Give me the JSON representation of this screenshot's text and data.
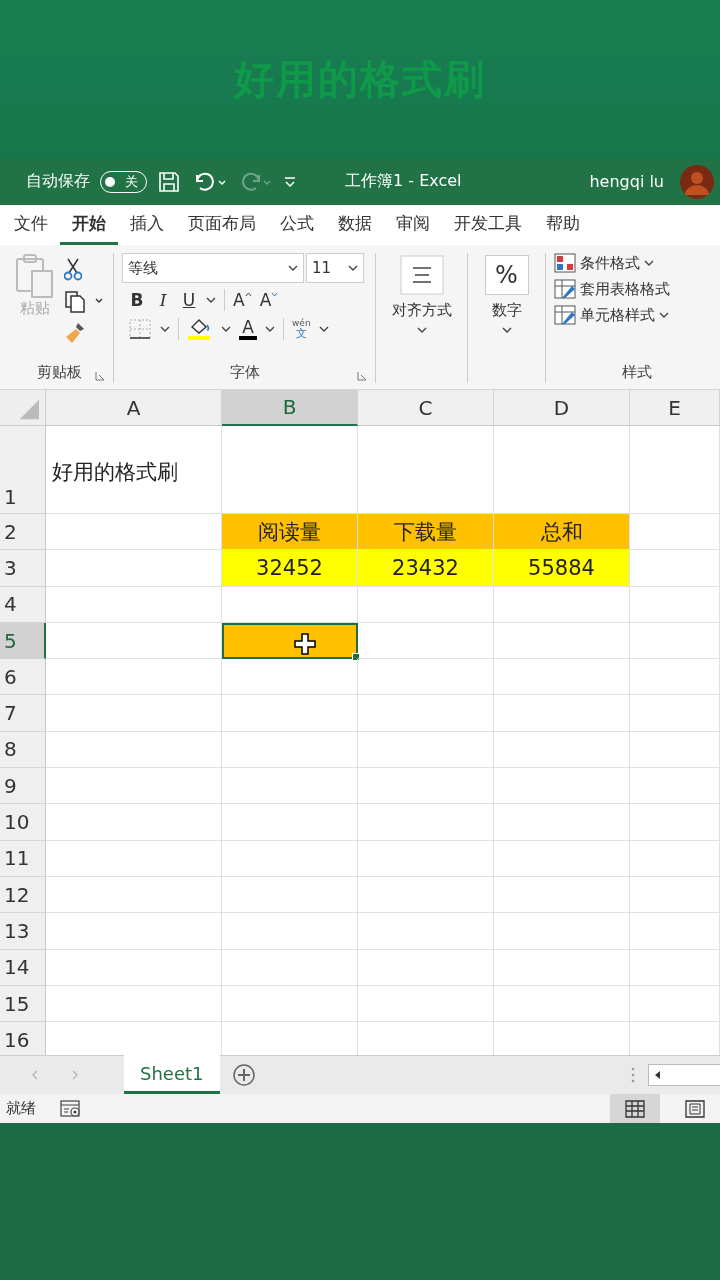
{
  "banner": {
    "title": "好用的格式刷"
  },
  "titlebar": {
    "autosave_label": "自动保存",
    "autosave_toggle": {
      "label": "关",
      "on": false
    },
    "doc_title": "工作簿1  -  Excel",
    "user": "hengqi lu"
  },
  "tabs": [
    {
      "label": "文件",
      "selected": false
    },
    {
      "label": "开始",
      "selected": true
    },
    {
      "label": "插入",
      "selected": false
    },
    {
      "label": "页面布局",
      "selected": false
    },
    {
      "label": "公式",
      "selected": false
    },
    {
      "label": "数据",
      "selected": false
    },
    {
      "label": "审阅",
      "selected": false
    },
    {
      "label": "开发工具",
      "selected": false
    },
    {
      "label": "帮助",
      "selected": false
    }
  ],
  "ribbon": {
    "clipboard": {
      "paste": "粘贴",
      "group": "剪贴板"
    },
    "font": {
      "font_name": "等线",
      "font_size": "11",
      "bold": "B",
      "italic": "I",
      "underline": "U",
      "grow": "A",
      "shrink": "A",
      "font_color": "A",
      "phonetic_top": "wén",
      "phonetic_bottom": "文",
      "group": "字体"
    },
    "alignment": {
      "label": "对齐方式"
    },
    "number": {
      "symbol": "%",
      "label": "数字"
    },
    "styles": {
      "items": [
        {
          "label": "条件格式",
          "dropdown": true
        },
        {
          "label": "套用表格格式",
          "dropdown": false
        },
        {
          "label": "单元格样式",
          "dropdown": true
        }
      ],
      "group": "样式"
    }
  },
  "sheet": {
    "columns": [
      {
        "label": "A",
        "selected": false
      },
      {
        "label": "B",
        "selected": true
      },
      {
        "label": "C",
        "selected": false
      },
      {
        "label": "D",
        "selected": false
      },
      {
        "label": "E",
        "selected": false
      }
    ],
    "rows": [
      {
        "label": "1",
        "selected": false,
        "tall": true,
        "cells": [
          {
            "text": "好用的格式刷"
          },
          {},
          {},
          {},
          {}
        ]
      },
      {
        "label": "2",
        "selected": false,
        "cells": [
          {},
          {
            "text": "阅读量",
            "color": "#ffc000"
          },
          {
            "text": "下载量",
            "color": "#ffc000"
          },
          {
            "text": "总和",
            "color": "#ffc000"
          },
          {}
        ]
      },
      {
        "label": "3",
        "selected": false,
        "cells": [
          {},
          {
            "text": "32452",
            "color": "#ffff00"
          },
          {
            "text": "23432",
            "color": "#ffff00"
          },
          {
            "text": "55884",
            "color": "#ffff00"
          },
          {}
        ]
      },
      {
        "label": "4",
        "selected": false,
        "cells": [
          {},
          {},
          {},
          {},
          {}
        ]
      },
      {
        "label": "5",
        "selected": true,
        "cells": [
          {},
          {
            "color": "#ffc000",
            "active": true
          },
          {},
          {},
          {}
        ]
      },
      {
        "label": "6",
        "selected": false,
        "cells": [
          {},
          {},
          {},
          {},
          {}
        ]
      },
      {
        "label": "7",
        "selected": false,
        "cells": [
          {},
          {},
          {},
          {},
          {}
        ]
      },
      {
        "label": "8",
        "selected": false,
        "cells": [
          {},
          {},
          {},
          {},
          {}
        ]
      },
      {
        "label": "9",
        "selected": false,
        "cells": [
          {},
          {},
          {},
          {},
          {}
        ]
      },
      {
        "label": "10",
        "selected": false,
        "cells": [
          {},
          {},
          {},
          {},
          {}
        ]
      },
      {
        "label": "11",
        "selected": false,
        "cells": [
          {},
          {},
          {},
          {},
          {}
        ]
      },
      {
        "label": "12",
        "selected": false,
        "cells": [
          {},
          {},
          {},
          {},
          {}
        ]
      },
      {
        "label": "13",
        "selected": false,
        "cells": [
          {},
          {},
          {},
          {},
          {}
        ]
      },
      {
        "label": "14",
        "selected": false,
        "cells": [
          {},
          {},
          {},
          {},
          {}
        ]
      },
      {
        "label": "15",
        "selected": false,
        "cells": [
          {},
          {},
          {},
          {},
          {}
        ]
      },
      {
        "label": "16",
        "selected": false,
        "cells": [
          {},
          {},
          {},
          {},
          {}
        ]
      }
    ]
  },
  "sheet_tabs": [
    {
      "label": "Sheet1",
      "selected": true
    }
  ],
  "status_bar": {
    "text": "就绪",
    "views": [
      {
        "kind": "normal",
        "selected": true
      },
      {
        "kind": "page_layout",
        "selected": false
      }
    ]
  }
}
